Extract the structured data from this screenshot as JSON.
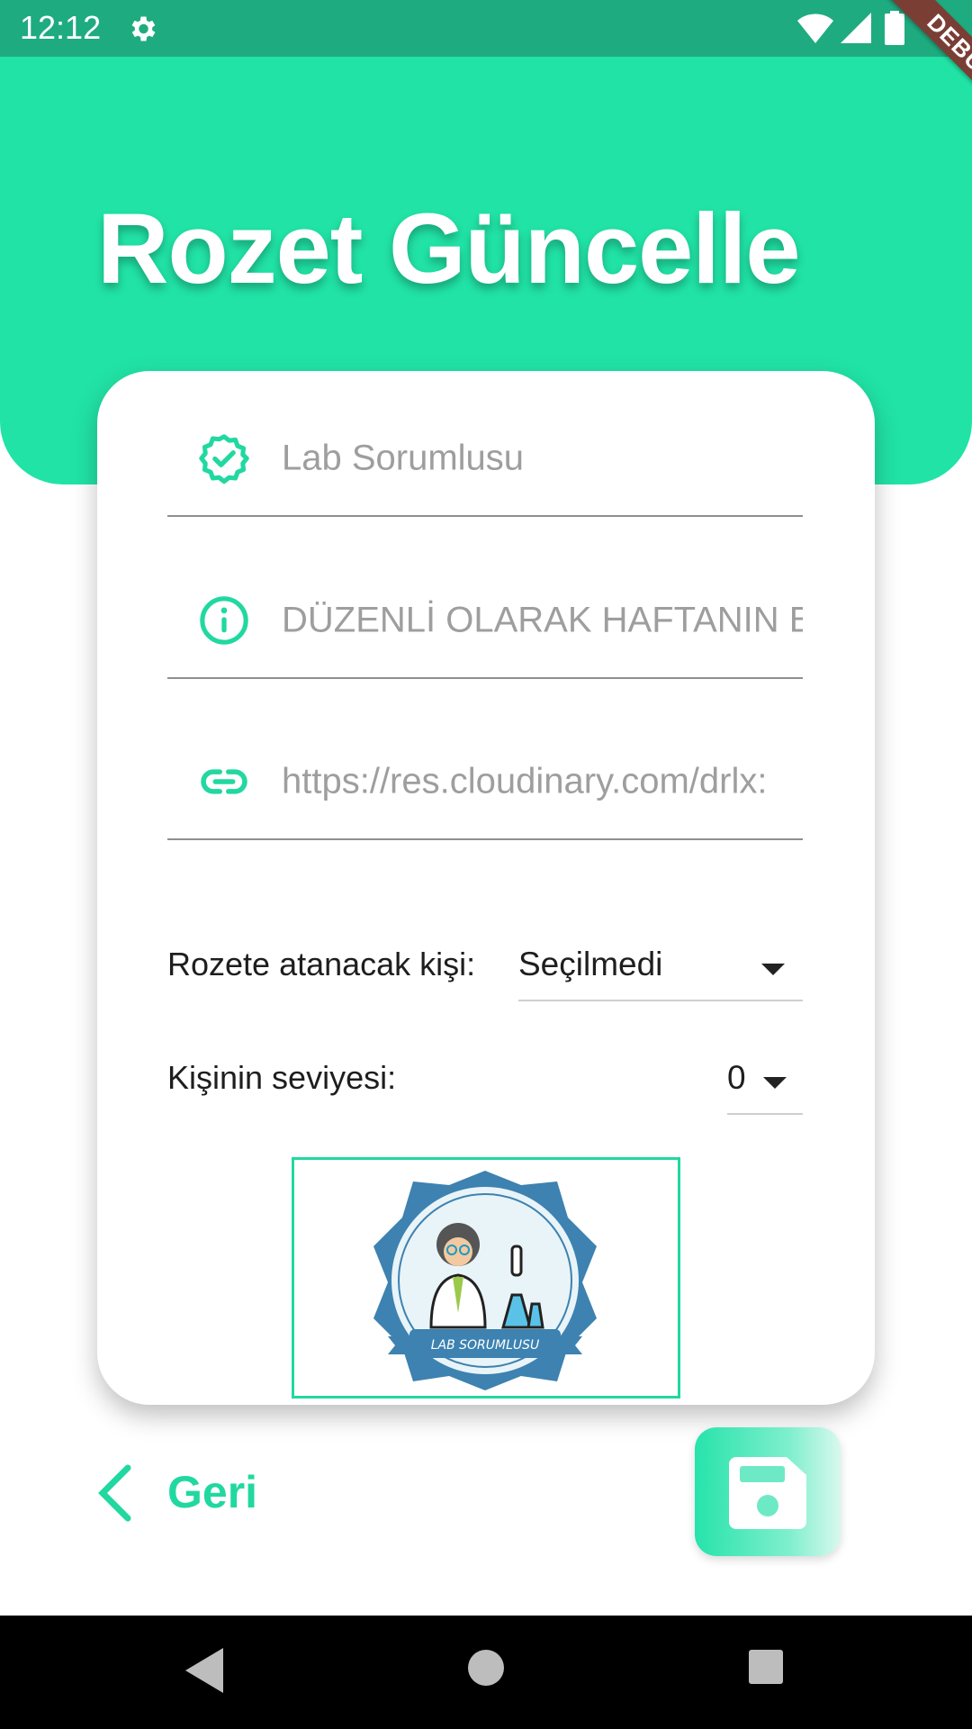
{
  "status_bar": {
    "time": "12:12"
  },
  "debug_banner": {
    "label": "DEBUG"
  },
  "header": {
    "title": "Rozet Güncelle"
  },
  "form": {
    "badge_name_value": "Lab Sorumlusu",
    "description_value": "DÜZENLİ OLARAK HAFTANIN B",
    "image_url_value": "https://res.cloudinary.com/drlx:",
    "assignee_label": "Rozete atanacak kişi:",
    "assignee_selected": "Seçilmedi",
    "level_label": "Kişinin seviyesi:",
    "level_selected": "0"
  },
  "badge_preview": {
    "caption": "LAB SORUMLUSU"
  },
  "actions": {
    "back_label": "Geri"
  },
  "colors": {
    "accent": "#21e3a6",
    "status_bar": "#1fab80",
    "accent_text": "#21d8a0"
  }
}
